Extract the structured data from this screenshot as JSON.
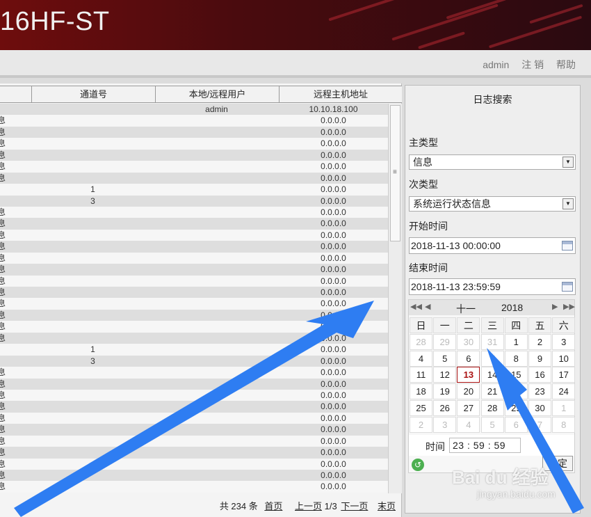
{
  "header": {
    "title": "16HF-ST"
  },
  "nav": {
    "user": "admin",
    "logout": "注 销",
    "help": "帮助"
  },
  "table": {
    "columns": [
      "通道号",
      "本地/远程用户",
      "远程主机地址"
    ],
    "rows": [
      {
        "type": "",
        "channel": "",
        "user": "admin",
        "host": "10.10.18.100"
      },
      {
        "type": "息",
        "channel": "",
        "user": "",
        "host": "0.0.0.0"
      },
      {
        "type": "息",
        "channel": "",
        "user": "",
        "host": "0.0.0.0"
      },
      {
        "type": "息",
        "channel": "",
        "user": "",
        "host": "0.0.0.0"
      },
      {
        "type": "息",
        "channel": "",
        "user": "",
        "host": "0.0.0.0"
      },
      {
        "type": "息",
        "channel": "",
        "user": "",
        "host": "0.0.0.0"
      },
      {
        "type": "息",
        "channel": "",
        "user": "",
        "host": "0.0.0.0"
      },
      {
        "type": "",
        "channel": "1",
        "user": "",
        "host": "0.0.0.0"
      },
      {
        "type": "",
        "channel": "3",
        "user": "",
        "host": "0.0.0.0"
      },
      {
        "type": "息",
        "channel": "",
        "user": "",
        "host": "0.0.0.0"
      },
      {
        "type": "息",
        "channel": "",
        "user": "",
        "host": "0.0.0.0"
      },
      {
        "type": "息",
        "channel": "",
        "user": "",
        "host": "0.0.0.0"
      },
      {
        "type": "息",
        "channel": "",
        "user": "",
        "host": "0.0.0.0"
      },
      {
        "type": "息",
        "channel": "",
        "user": "",
        "host": "0.0.0.0"
      },
      {
        "type": "息",
        "channel": "",
        "user": "",
        "host": "0.0.0.0"
      },
      {
        "type": "息",
        "channel": "",
        "user": "",
        "host": "0.0.0.0"
      },
      {
        "type": "息",
        "channel": "",
        "user": "",
        "host": "0.0.0.0"
      },
      {
        "type": "息",
        "channel": "",
        "user": "",
        "host": "0.0.0.0"
      },
      {
        "type": "息",
        "channel": "",
        "user": "",
        "host": "0.0.0.0"
      },
      {
        "type": "息",
        "channel": "",
        "user": "",
        "host": "0.0.0.0"
      },
      {
        "type": "息",
        "channel": "",
        "user": "",
        "host": "0.0.0.0"
      },
      {
        "type": "",
        "channel": "1",
        "user": "",
        "host": "0.0.0.0"
      },
      {
        "type": "",
        "channel": "3",
        "user": "",
        "host": "0.0.0.0"
      },
      {
        "type": "息",
        "channel": "",
        "user": "",
        "host": "0.0.0.0"
      },
      {
        "type": "息",
        "channel": "",
        "user": "",
        "host": "0.0.0.0"
      },
      {
        "type": "息",
        "channel": "",
        "user": "",
        "host": "0.0.0.0"
      },
      {
        "type": "息",
        "channel": "",
        "user": "",
        "host": "0.0.0.0"
      },
      {
        "type": "息",
        "channel": "",
        "user": "",
        "host": "0.0.0.0"
      },
      {
        "type": "息",
        "channel": "",
        "user": "",
        "host": "0.0.0.0"
      },
      {
        "type": "息",
        "channel": "",
        "user": "",
        "host": "0.0.0.0"
      },
      {
        "type": "息",
        "channel": "",
        "user": "",
        "host": "0.0.0.0"
      },
      {
        "type": "息",
        "channel": "",
        "user": "",
        "host": "0.0.0.0"
      },
      {
        "type": "息",
        "channel": "",
        "user": "",
        "host": "0.0.0.0"
      },
      {
        "type": "息",
        "channel": "",
        "user": "",
        "host": "0.0.0.0"
      }
    ]
  },
  "pager": {
    "total": "共 234 条",
    "first": "首页",
    "prev": "上一页",
    "page": "1/3",
    "next": "下一页",
    "last": "末页"
  },
  "search": {
    "title": "日志搜索",
    "main_type_label": "主类型",
    "main_type_value": "信息",
    "sub_type_label": "次类型",
    "sub_type_value": "系统运行状态信息",
    "start_label": "开始时间",
    "start_value": "2018-11-13 00:00:00",
    "end_label": "结束时间",
    "end_value": "2018-11-13 23:59:59"
  },
  "calendar": {
    "nav_prev_year": "◀◀",
    "nav_prev_month": "◀",
    "nav_next_month": "▶",
    "nav_next_year": "▶▶",
    "month": "十一",
    "year": "2018",
    "weekdays": [
      "日",
      "一",
      "二",
      "三",
      "四",
      "五",
      "六"
    ],
    "days": [
      [
        "28",
        "29",
        "30",
        "31",
        "1",
        "2",
        "3"
      ],
      [
        "4",
        "5",
        "6",
        "7",
        "8",
        "9",
        "10"
      ],
      [
        "11",
        "12",
        "13",
        "14",
        "15",
        "16",
        "17"
      ],
      [
        "18",
        "19",
        "20",
        "21",
        "22",
        "23",
        "24"
      ],
      [
        "25",
        "26",
        "27",
        "28",
        "29",
        "30",
        "1"
      ],
      [
        "2",
        "3",
        "4",
        "5",
        "6",
        "7",
        "8"
      ]
    ],
    "other_month": [
      [
        true,
        true,
        true,
        true,
        false,
        false,
        false
      ],
      [
        false,
        false,
        false,
        false,
        false,
        false,
        false
      ],
      [
        false,
        false,
        false,
        false,
        false,
        false,
        false
      ],
      [
        false,
        false,
        false,
        false,
        false,
        false,
        false
      ],
      [
        false,
        false,
        false,
        false,
        false,
        false,
        true
      ],
      [
        true,
        true,
        true,
        true,
        true,
        true,
        true
      ]
    ],
    "selected": "13",
    "time_label": "时间",
    "time_value": "23 : 59 : 59",
    "ok": "确定"
  },
  "watermark": {
    "brand": "Bai du 经验",
    "url": "jingyan.baidu.com"
  },
  "colors": {
    "header": "#6e0d0d",
    "arrow": "#2e7df2",
    "selected": "#aa1111"
  }
}
